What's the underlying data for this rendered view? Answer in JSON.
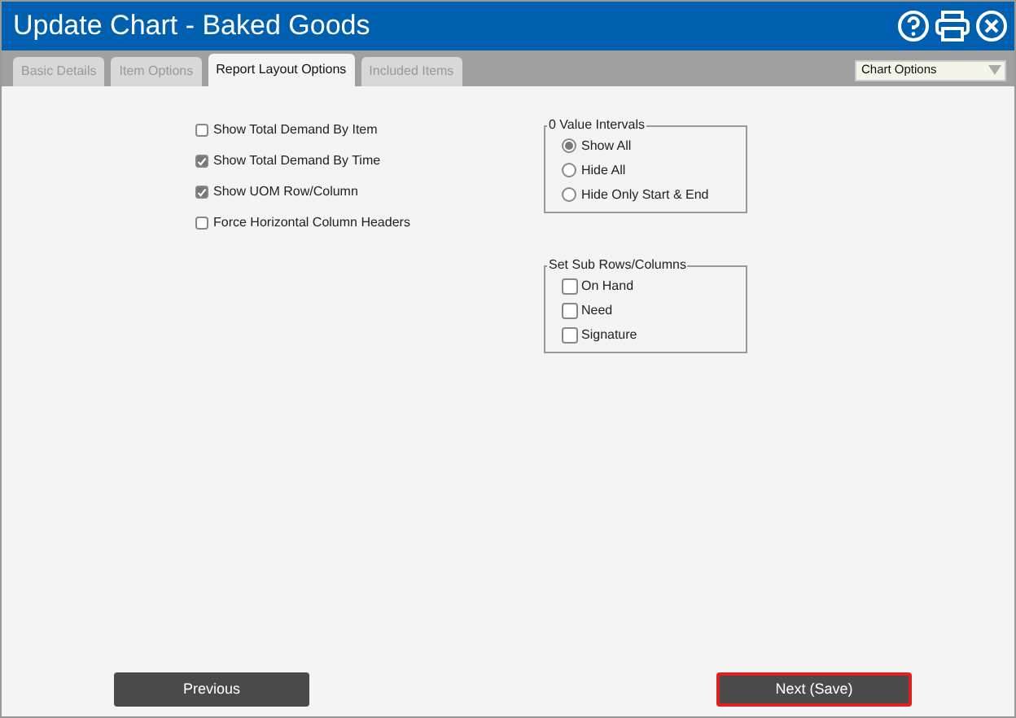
{
  "window": {
    "title": "Update Chart - Baked Goods"
  },
  "tabs": [
    {
      "label": "Basic Details",
      "selected": false
    },
    {
      "label": "Item Options",
      "selected": false
    },
    {
      "label": "Report Layout Options",
      "selected": true
    },
    {
      "label": "Included Items",
      "selected": false
    }
  ],
  "chart_options": {
    "value": "Chart Options"
  },
  "options": [
    {
      "label": "Show Total Demand By Item",
      "checked": false
    },
    {
      "label": "Show Total Demand By Time",
      "checked": true
    },
    {
      "label": "Show UOM Row/Column",
      "checked": true
    },
    {
      "label": "Force Horizontal Column Headers",
      "checked": false
    }
  ],
  "zero_value_intervals": {
    "title": "0 Value Intervals",
    "choices": [
      {
        "label": "Show All",
        "selected": true
      },
      {
        "label": "Hide All",
        "selected": false
      },
      {
        "label": "Hide Only Start & End",
        "selected": false
      }
    ]
  },
  "sub_rows_columns": {
    "title": "Set Sub Rows/Columns",
    "choices": [
      {
        "label": "On Hand",
        "checked": false
      },
      {
        "label": "Need",
        "checked": false
      },
      {
        "label": "Signature",
        "checked": false
      }
    ]
  },
  "buttons": [
    {
      "label": "Previous",
      "highlighted": false
    },
    {
      "label": "Next (Save)",
      "highlighted": true
    }
  ]
}
